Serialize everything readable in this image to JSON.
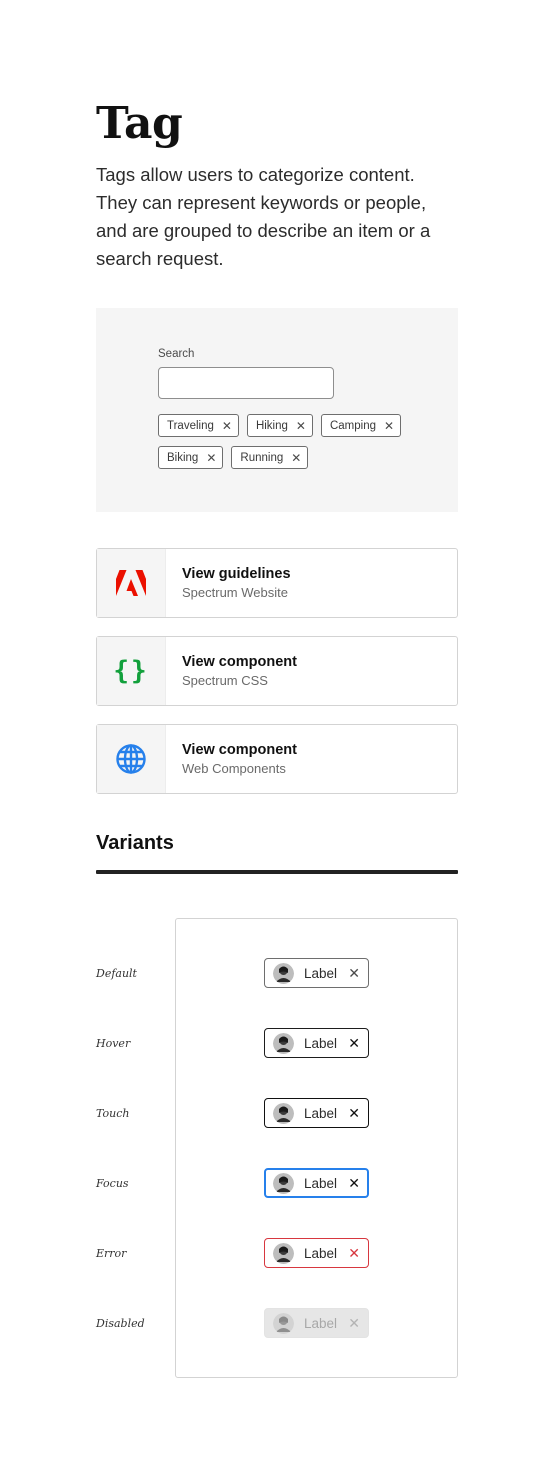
{
  "title": "Tag",
  "description": "Tags allow users to categorize content. They can represent keywords or people, and are grouped to describe an item or a search request.",
  "demo": {
    "search_label": "Search",
    "search_value": "",
    "tags": [
      "Traveling",
      "Hiking",
      "Camping",
      "Biking",
      "Running"
    ],
    "remove_glyph": "✕"
  },
  "links": [
    {
      "title": "View guidelines",
      "subtitle": "Spectrum Website",
      "icon": "adobe-logo-icon"
    },
    {
      "title": "View component",
      "subtitle": "Spectrum CSS",
      "icon": "curly-braces-icon"
    },
    {
      "title": "View component",
      "subtitle": "Web Components",
      "icon": "globe-icon"
    }
  ],
  "variants_section": {
    "title": "Variants",
    "tag_label": "Label",
    "remove_glyph": "✕",
    "states": [
      "Default",
      "Hover",
      "Touch",
      "Focus",
      "Error",
      "Disabled"
    ]
  },
  "colors": {
    "adobe_red": "#eb1000",
    "code_green": "#12a03c",
    "globe_blue": "#2680eb",
    "focus_blue": "#2680eb",
    "error_red": "#d7373f"
  }
}
